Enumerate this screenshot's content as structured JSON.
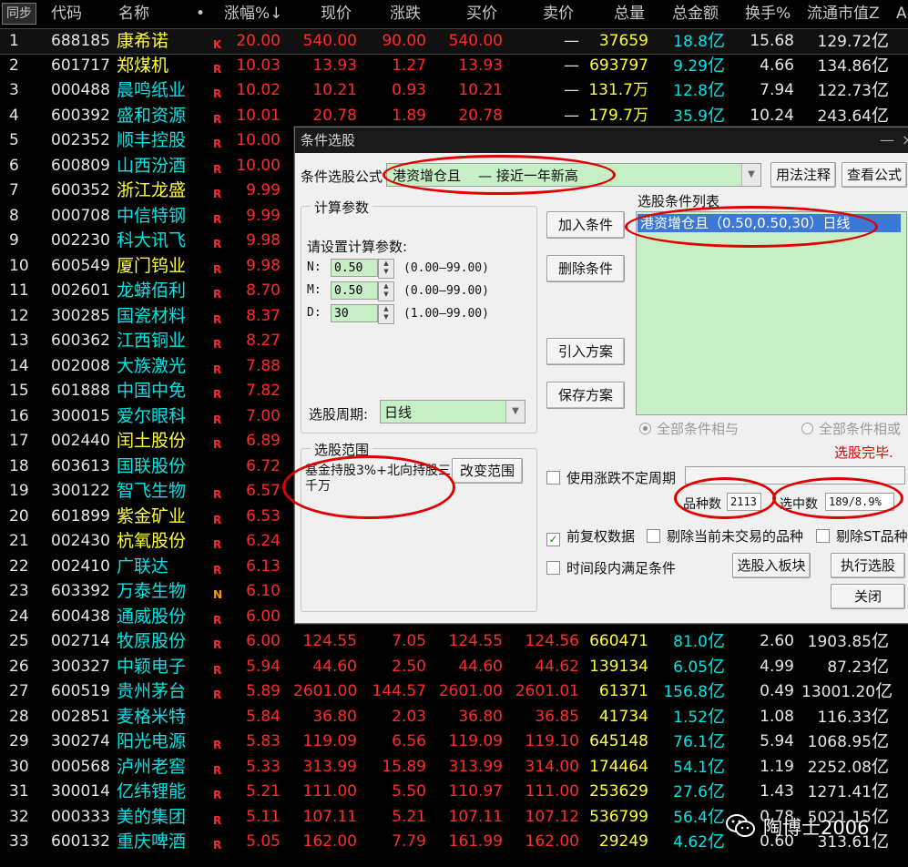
{
  "grid": {
    "headers": {
      "sync": "同步",
      "code": "代码",
      "name": "名称",
      "dot": "•",
      "pct": "涨幅%",
      "sort_arrow": "↓",
      "price": "现价",
      "change": "涨跌",
      "bid": "买价",
      "ask": "卖价",
      "volume": "总量",
      "amount": "总金额",
      "turnover": "换手%",
      "mcap": "流通市值Z",
      "more": "A"
    },
    "rows": [
      {
        "i": "1",
        "code": "688185",
        "name": "康希诺",
        "flag": "K",
        "pct": "20.00",
        "price": "540.00",
        "change": "90.00",
        "bid": "540.00",
        "ask": "—",
        "vol": "37659",
        "amt": "18.8",
        "amtu": "亿",
        "turn": "15.68",
        "mcap": "129.72",
        "mcapu": "亿",
        "ny": true
      },
      {
        "i": "2",
        "code": "601717",
        "name": "郑煤机",
        "flag": "R",
        "pct": "10.03",
        "price": "13.93",
        "change": "1.27",
        "bid": "13.93",
        "ask": "—",
        "vol": "693797",
        "amt": "9.29",
        "amtu": "亿",
        "turn": "4.66",
        "mcap": "134.86",
        "mcapu": "亿",
        "ny": true
      },
      {
        "i": "3",
        "code": "000488",
        "name": "晨鸣纸业",
        "flag": "R",
        "pct": "10.02",
        "price": "10.21",
        "change": "0.93",
        "bid": "10.21",
        "ask": "—",
        "vol": "131.7万",
        "amt": "12.8",
        "amtu": "亿",
        "turn": "7.94",
        "mcap": "122.73",
        "mcapu": "亿",
        "ny": false
      },
      {
        "i": "4",
        "code": "600392",
        "name": "盛和资源",
        "flag": "R",
        "pct": "10.01",
        "price": "20.78",
        "change": "1.89",
        "bid": "20.78",
        "ask": "—",
        "vol": "179.7万",
        "amt": "35.9",
        "amtu": "亿",
        "turn": "10.24",
        "mcap": "243.64",
        "mcapu": "亿",
        "ny": false
      },
      {
        "i": "5",
        "code": "002352",
        "name": "顺丰控股",
        "flag": "R",
        "pct": "10.00"
      },
      {
        "i": "6",
        "code": "600809",
        "name": "山西汾酒",
        "flag": "R",
        "pct": "10.00"
      },
      {
        "i": "7",
        "code": "600352",
        "name": "浙江龙盛",
        "flag": "R",
        "pct": "9.99",
        "ny": true
      },
      {
        "i": "8",
        "code": "000708",
        "name": "中信特钢",
        "flag": "R",
        "pct": "9.99"
      },
      {
        "i": "9",
        "code": "002230",
        "name": "科大讯飞",
        "flag": "R",
        "pct": "9.98"
      },
      {
        "i": "10",
        "code": "600549",
        "name": "厦门钨业",
        "flag": "R",
        "pct": "9.98",
        "ny": true
      },
      {
        "i": "11",
        "code": "002601",
        "name": "龙蟒佰利",
        "flag": "R",
        "pct": "8.70"
      },
      {
        "i": "12",
        "code": "300285",
        "name": "国瓷材料",
        "flag": "R",
        "pct": "8.37"
      },
      {
        "i": "13",
        "code": "600362",
        "name": "江西铜业",
        "flag": "R",
        "pct": "8.27"
      },
      {
        "i": "14",
        "code": "002008",
        "name": "大族激光",
        "flag": "R",
        "pct": "7.88"
      },
      {
        "i": "15",
        "code": "601888",
        "name": "中国中免",
        "flag": "R",
        "pct": "7.82"
      },
      {
        "i": "16",
        "code": "300015",
        "name": "爱尔眼科",
        "flag": "R",
        "pct": "7.00"
      },
      {
        "i": "17",
        "code": "002440",
        "name": "闰土股份",
        "flag": "R",
        "pct": "6.89",
        "ny": true
      },
      {
        "i": "18",
        "code": "603613",
        "name": "国联股份",
        "flag": "",
        "pct": "6.72"
      },
      {
        "i": "19",
        "code": "300122",
        "name": "智飞生物",
        "flag": "R",
        "pct": "6.57"
      },
      {
        "i": "20",
        "code": "601899",
        "name": "紫金矿业",
        "flag": "R",
        "pct": "6.53",
        "ny": true
      },
      {
        "i": "21",
        "code": "002430",
        "name": "杭氧股份",
        "flag": "R",
        "pct": "6.24",
        "ny": true
      },
      {
        "i": "22",
        "code": "002410",
        "name": "广联达",
        "flag": "R",
        "pct": "6.13"
      },
      {
        "i": "23",
        "code": "603392",
        "name": "万泰生物",
        "flag": "N",
        "pct": "6.10"
      },
      {
        "i": "24",
        "code": "600438",
        "name": "通威股份",
        "flag": "R",
        "pct": "6.00"
      },
      {
        "i": "25",
        "code": "002714",
        "name": "牧原股份",
        "flag": "R",
        "pct": "6.00",
        "price": "124.55",
        "change": "7.05",
        "bid": "124.55",
        "ask": "124.56",
        "vol": "660471",
        "amt": "81.0",
        "amtu": "亿",
        "turn": "2.60",
        "mcap": "1903.85",
        "mcapu": "亿"
      },
      {
        "i": "26",
        "code": "300327",
        "name": "中颖电子",
        "flag": "R",
        "pct": "5.94",
        "price": "44.60",
        "change": "2.50",
        "bid": "44.60",
        "ask": "44.62",
        "vol": "139134",
        "amt": "6.05",
        "amtu": "亿",
        "turn": "4.99",
        "mcap": "87.23",
        "mcapu": "亿"
      },
      {
        "i": "27",
        "code": "600519",
        "name": "贵州茅台",
        "flag": "R",
        "pct": "5.89",
        "price": "2601.00",
        "change": "144.57",
        "bid": "2601.00",
        "ask": "2601.01",
        "vol": "61371",
        "amt": "156.8",
        "amtu": "亿",
        "turn": "0.49",
        "mcap": "13001.20",
        "mcapu": "亿"
      },
      {
        "i": "28",
        "code": "002851",
        "name": "麦格米特",
        "flag": "",
        "pct": "5.84",
        "price": "36.80",
        "change": "2.03",
        "bid": "36.80",
        "ask": "36.85",
        "vol": "41734",
        "amt": "1.52",
        "amtu": "亿",
        "turn": "1.08",
        "mcap": "116.33",
        "mcapu": "亿"
      },
      {
        "i": "29",
        "code": "300274",
        "name": "阳光电源",
        "flag": "R",
        "pct": "5.83",
        "price": "119.09",
        "change": "6.56",
        "bid": "119.09",
        "ask": "119.10",
        "vol": "645148",
        "amt": "76.1",
        "amtu": "亿",
        "turn": "5.94",
        "mcap": "1068.95",
        "mcapu": "亿"
      },
      {
        "i": "30",
        "code": "000568",
        "name": "泸州老窖",
        "flag": "R",
        "pct": "5.33",
        "price": "313.99",
        "change": "15.89",
        "bid": "313.99",
        "ask": "314.00",
        "vol": "174464",
        "amt": "54.1",
        "amtu": "亿",
        "turn": "1.19",
        "mcap": "2252.08",
        "mcapu": "亿"
      },
      {
        "i": "31",
        "code": "300014",
        "name": "亿纬锂能",
        "flag": "R",
        "pct": "5.21",
        "price": "111.00",
        "change": "5.50",
        "bid": "110.97",
        "ask": "111.00",
        "vol": "253629",
        "amt": "27.6",
        "amtu": "亿",
        "turn": "1.43",
        "mcap": "1271.41",
        "mcapu": "亿"
      },
      {
        "i": "32",
        "code": "000333",
        "name": "美的集团",
        "flag": "R",
        "pct": "5.11",
        "price": "107.11",
        "change": "5.21",
        "bid": "107.11",
        "ask": "107.12",
        "vol": "536799",
        "amt": "56.4",
        "amtu": "亿",
        "turn": "0.78",
        "mcap": "5021.15",
        "mcapu": "亿"
      },
      {
        "i": "33",
        "code": "600132",
        "name": "重庆啤酒",
        "flag": "R",
        "pct": "5.05",
        "price": "162.00",
        "change": "7.79",
        "bid": "161.99",
        "ask": "162.00",
        "vol": "29249",
        "amt": "4.62",
        "amtu": "亿",
        "turn": "0.60",
        "mcap": "313.61",
        "mcapu": "亿"
      }
    ]
  },
  "dialog": {
    "title": "条件选股",
    "min": "—",
    "close": "×",
    "formula_label": "条件选股公式",
    "formula_value": "港资增仓且    — 接近一年新高",
    "usage_btn": "用法注释",
    "view_btn": "查看公式",
    "params_group": "计算参数",
    "params_prompt": "请设置计算参数:",
    "params": [
      {
        "name": "N:",
        "value": "0.50",
        "range": "(0.00—99.00)"
      },
      {
        "name": "M:",
        "value": "0.50",
        "range": "(0.00—99.00)"
      },
      {
        "name": "D:",
        "value": "30",
        "range": "(1.00—99.00)"
      }
    ],
    "period_label": "选股周期:",
    "period_value": "日线",
    "add_btn": "加入条件",
    "del_btn": "删除条件",
    "import_btn": "引入方案",
    "save_btn": "保存方案",
    "list_label": "选股条件列表",
    "list_items": [
      "港资增仓且（0.50,0.50,30）日线"
    ],
    "radio_and": "全部条件相与",
    "radio_or": "全部条件相或",
    "status": "选股完毕.",
    "scope_group": "选股范围",
    "scope_text": "基金持股3%+北向持股三千万",
    "change_scope_btn": "改变范围",
    "chk_uncertain": "使用涨跌不定周期",
    "count_label": "品种数",
    "count_value": "2113",
    "selected_label": "选中数",
    "selected_value": "189/8.9%",
    "chk_prefq": "前复权数据",
    "chk_exclude_notrade": "剔除当前未交易的品种",
    "chk_exclude_st": "剔除ST品种",
    "chk_period": "时间段内满足条件",
    "to_block_btn": "选股入板块",
    "exec_btn": "执行选股",
    "close_btn": "关闭",
    "check_mark": "✓",
    "dd_arrow": "▼",
    "spin_up": "▲",
    "spin_dn": "▼"
  },
  "watermark": {
    "text": "陶博士2006"
  },
  "colors": {
    "up_red": "#ff2a2a",
    "cyan": "#00e5e5",
    "yellow": "#ffff33",
    "listbox_green": "#c6efc6",
    "select_blue": "#3b78d8",
    "annot_red": "#e00000"
  }
}
